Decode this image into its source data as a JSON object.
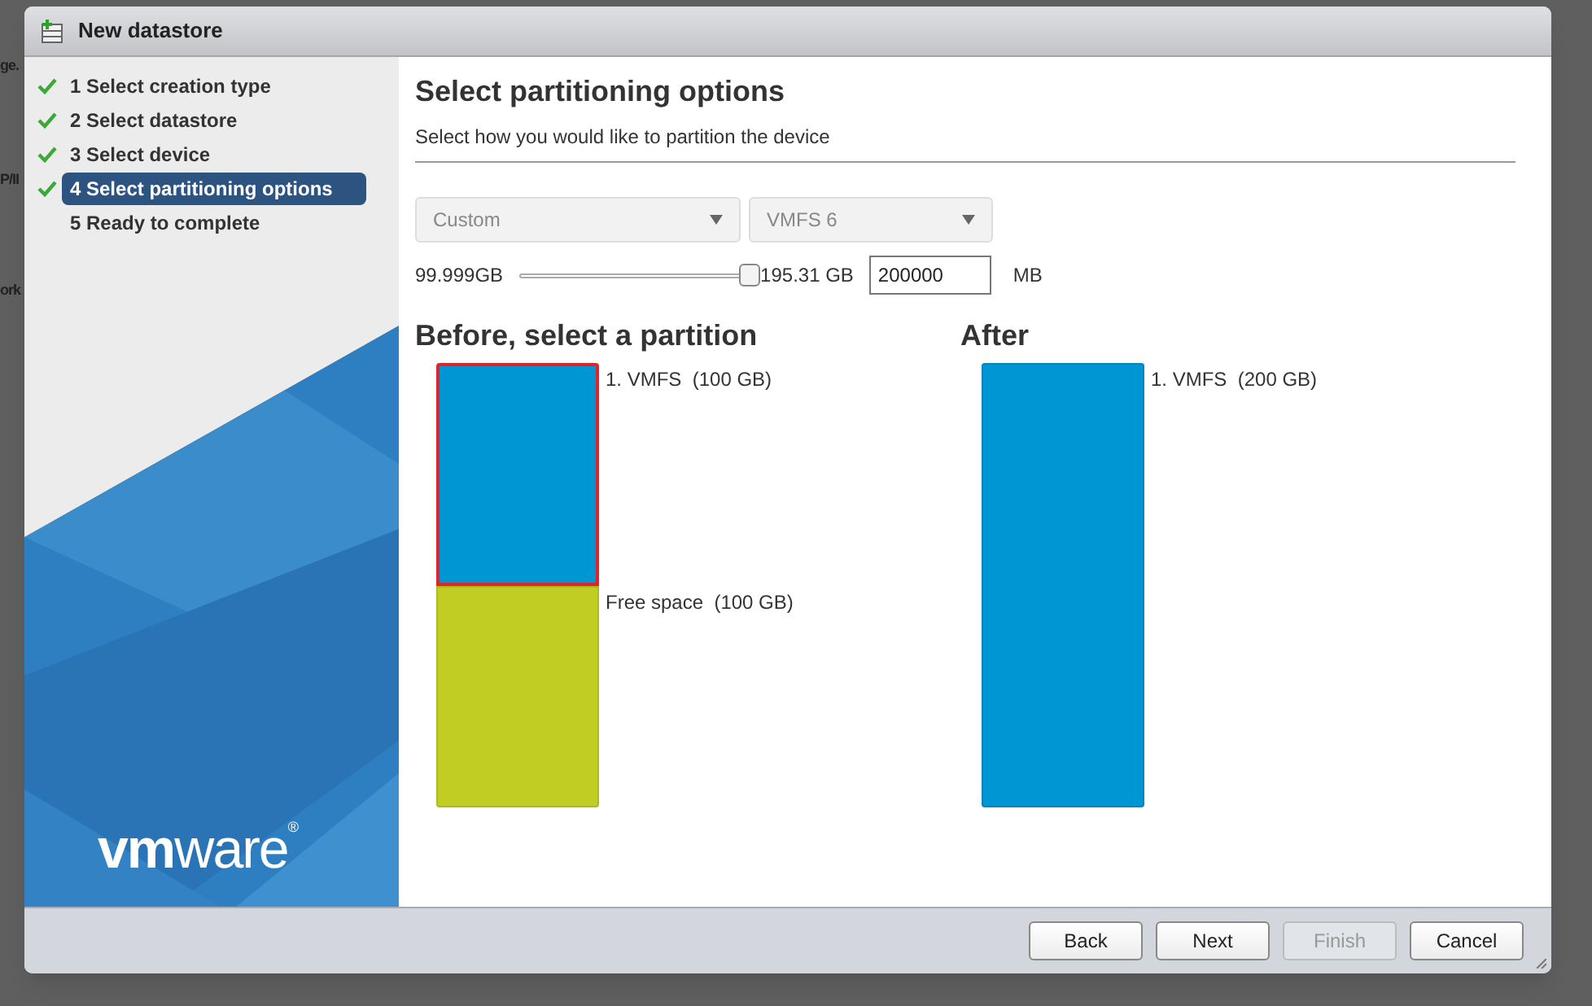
{
  "background_fragments": [
    "ge.",
    "P/II",
    "ork"
  ],
  "window": {
    "title": "New datastore"
  },
  "steps": [
    {
      "label": "1 Select creation type",
      "done": true,
      "selected": false
    },
    {
      "label": "2 Select datastore",
      "done": true,
      "selected": false
    },
    {
      "label": "3 Select device",
      "done": true,
      "selected": false
    },
    {
      "label": "4 Select partitioning options",
      "done": true,
      "selected": true
    },
    {
      "label": "5 Ready to complete",
      "done": false,
      "selected": false
    }
  ],
  "logo": "**vm**ware$^{®}$",
  "page": {
    "title": "Select partitioning options",
    "subtitle": "Select how you would like to partition the device"
  },
  "dropdowns": [
    {
      "value": "Custom"
    },
    {
      "value": "VMFS 6"
    }
  ],
  "size": {
    "min_label": "99.999GB",
    "level": 1,
    "max_label": "195.31 GB",
    "value": "200000",
    "unit": "MB"
  },
  "before": {
    "title": "Before, select a partition",
    "partitions": [
      {
        "label": "1. VMFS  (100 GB)",
        "color": "#0095d3",
        "selected": true
      },
      {
        "label": "Free space  (100 GB)",
        "color": "#c2cd23",
        "selected": false
      }
    ]
  },
  "after": {
    "title": "After",
    "partitions": [
      {
        "label": "1. VMFS  (200 GB)",
        "color": "#0095d3",
        "selected": false
      }
    ]
  },
  "buttons": [
    {
      "label": "Back",
      "disabled": false
    },
    {
      "label": "Next",
      "disabled": false
    },
    {
      "label": "Finish",
      "disabled": true
    },
    {
      "label": "Cancel",
      "disabled": false
    }
  ]
}
